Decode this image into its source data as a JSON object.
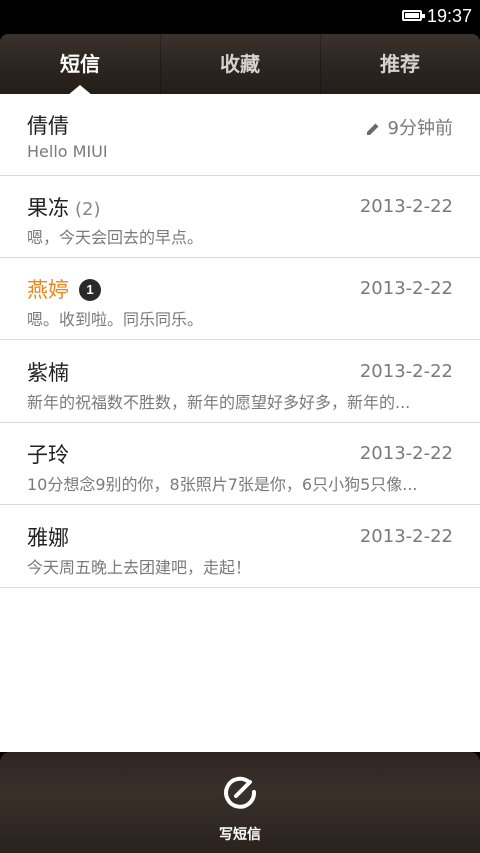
{
  "status_bar": {
    "time": "19:37",
    "battery_icon": "battery-icon"
  },
  "tabs": [
    {
      "label": "短信",
      "active": true
    },
    {
      "label": "收藏",
      "active": false
    },
    {
      "label": "推荐",
      "active": false
    }
  ],
  "conversations": [
    {
      "name": "倩倩",
      "count": "",
      "badge": "",
      "date": "9分钟前",
      "draft": true,
      "preview": "Hello MIUI"
    },
    {
      "name": "果冻",
      "count": "(2)",
      "badge": "",
      "date": "2013-2-22",
      "draft": false,
      "preview": "嗯，今天会回去的早点。"
    },
    {
      "name": "燕婷",
      "count": "",
      "badge": "1",
      "date": "2013-2-22",
      "draft": false,
      "preview": "嗯。收到啦。同乐同乐。"
    },
    {
      "name": "紫楠",
      "count": "",
      "badge": "",
      "date": "2013-2-22",
      "draft": false,
      "preview": "新年的祝福数不胜数，新年的愿望好多好多，新年的..."
    },
    {
      "name": "子玲",
      "count": "",
      "badge": "",
      "date": "2013-2-22",
      "draft": false,
      "preview": "10分想念9别的你，8张照片7张是你，6只小狗5只像..."
    },
    {
      "name": "雅娜",
      "count": "",
      "badge": "",
      "date": "2013-2-22",
      "draft": false,
      "preview": "今天周五晚上去团建吧，走起！"
    }
  ],
  "bottom_bar": {
    "compose_label": "写短信",
    "compose_icon": "compose-icon"
  },
  "colors": {
    "unread_name": "#f08519",
    "tab_bg": "#2d2520",
    "text_secondary": "#7a7a7a"
  }
}
